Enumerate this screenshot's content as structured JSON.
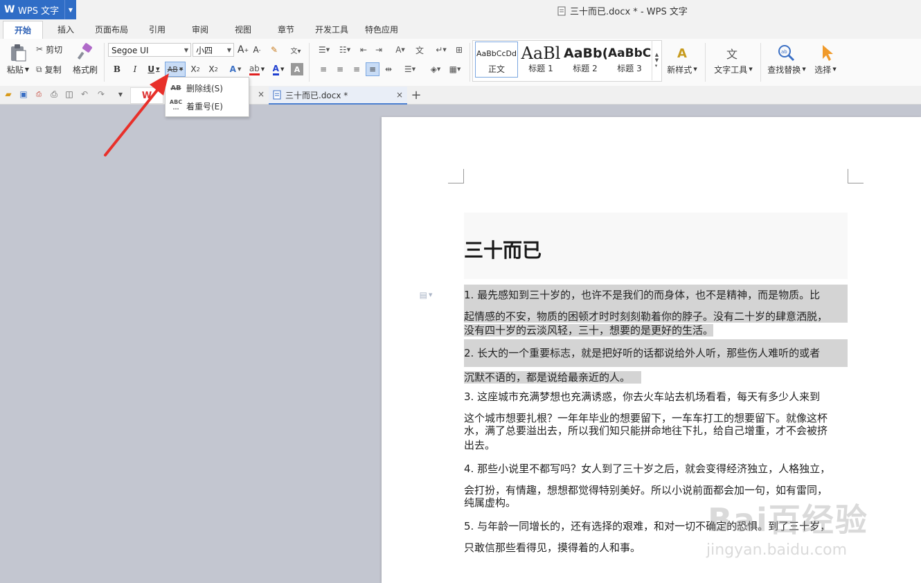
{
  "app": {
    "name": "WPS 文字",
    "window_title": "三十而已.docx * - WPS 文字"
  },
  "menu_tabs": [
    "开始",
    "插入",
    "页面布局",
    "引用",
    "审阅",
    "视图",
    "章节",
    "开发工具",
    "特色应用"
  ],
  "clipboard": {
    "paste": "粘贴",
    "cut": "剪切",
    "copy": "复制",
    "format_painter": "格式刷"
  },
  "font": {
    "name": "Segoe UI",
    "size": "小四"
  },
  "styles": [
    {
      "sample": "AaBbCcDd",
      "name": "正文"
    },
    {
      "sample": "AaBl",
      "name": "标题 1"
    },
    {
      "sample": "AaBb(",
      "name": "标题 2"
    },
    {
      "sample": "AaBbC",
      "name": "标题 3"
    }
  ],
  "tools": {
    "new_style": "新样式",
    "text_tools": "文字工具",
    "find_replace": "查找替换",
    "select": "选择"
  },
  "document_tab": "三十而已.docx *",
  "dropdown": {
    "strikethrough": "删除线(S)",
    "emphasis": "着重号(E)"
  },
  "document": {
    "title": "三十而已",
    "paragraphs": [
      {
        "lines": [
          "1. 最先感知到三十岁的，也许不是我们的而身体，也不是精神，而是物质。比",
          "起情感的不安，物质的困顿才时时刻刻勒着你的脖子。没有二十岁的肆意洒脱，",
          "没有四十岁的云淡风轻，三十，想要的是更好的生活。"
        ]
      },
      {
        "lines": [
          "2. 长大的一个重要标志，就是把好听的话都说给外人听，那些伤人难听的或者",
          "沉默不语的，都是说给最亲近的人。"
        ]
      },
      {
        "lines": [
          "3. 这座城市充满梦想也充满诱惑，你去火车站去机场看看，每天有多少人来到",
          "这个城市想要扎根？一年年毕业的想要留下，一车车打工的想要留下。就像这杯",
          "水，满了总要溢出去，所以我们知只能拼命地往下扎，给自己增重，才不会被挤",
          "出去。"
        ]
      },
      {
        "lines": [
          "4. 那些小说里不都写吗？女人到了三十岁之后，就会变得经济独立，人格独立，",
          "会打扮，有情趣，想想都觉得特别美好。所以小说前面都会加一句，如有雷同，",
          "纯属虚构。"
        ]
      },
      {
        "lines": [
          "5. 与年龄一同增长的，还有选择的艰难，和对一切不确定的恐惧。到了三十岁，",
          "只敢信那些看得见，摸得着的人和事。"
        ]
      }
    ]
  },
  "watermark": {
    "logo": "Bai百经验",
    "url": "jingyan.baidu.com"
  },
  "colors": {
    "accent": "#2f6dc6",
    "arrow": "#e8302a",
    "highlight": "#d4d4d4"
  }
}
